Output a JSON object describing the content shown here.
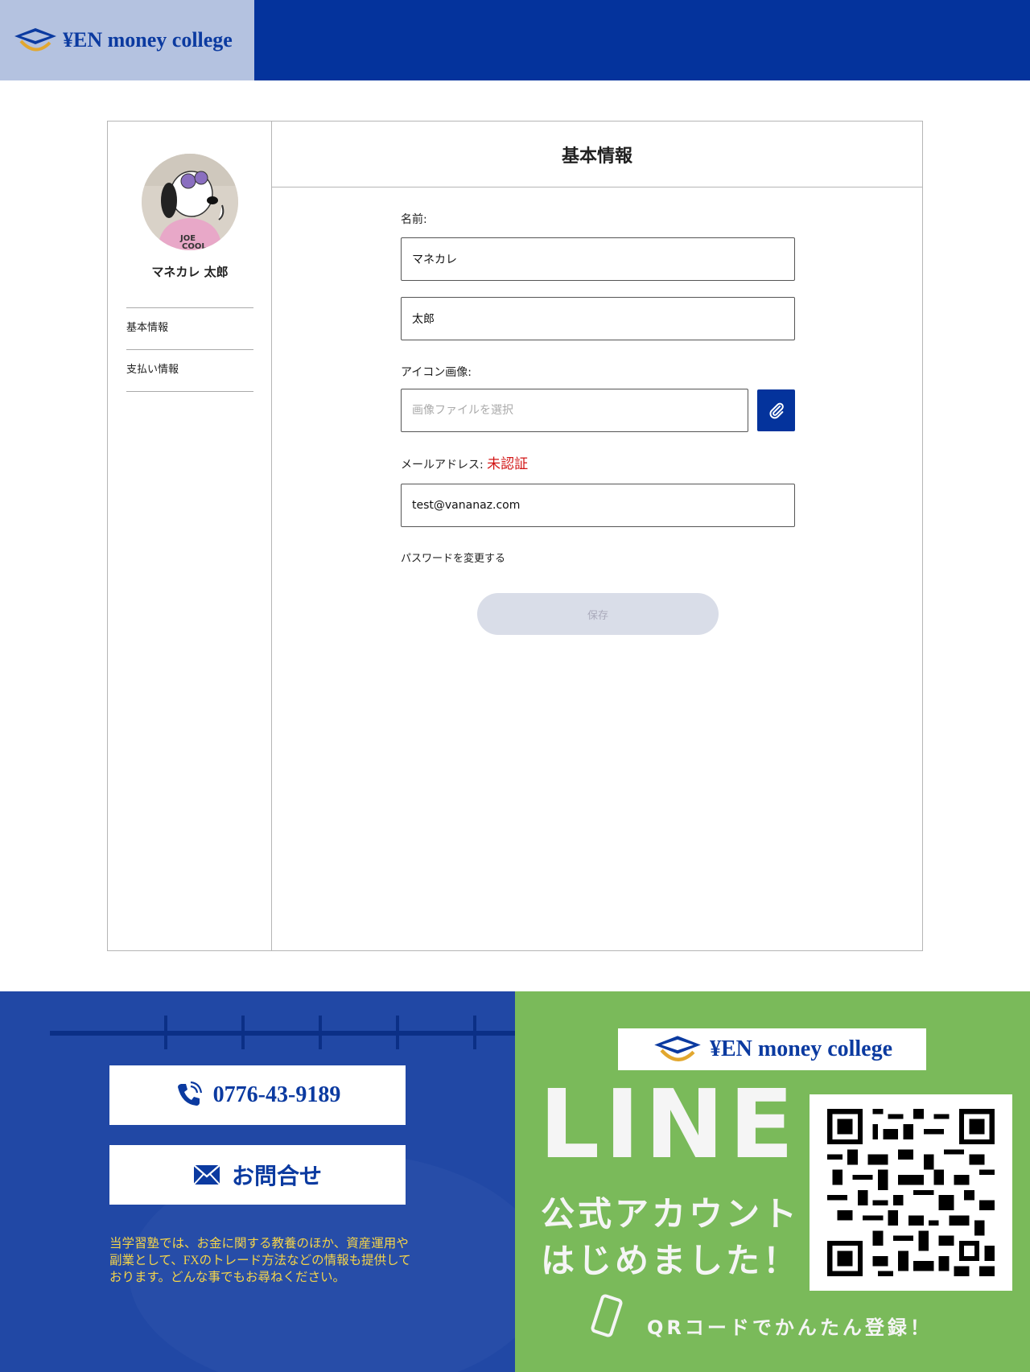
{
  "header": {
    "logo_text": "¥EN money college"
  },
  "profile": {
    "name": "マネカレ 太郎"
  },
  "sidebar": {
    "items": [
      {
        "label": "基本情報"
      },
      {
        "label": "支払い情報"
      }
    ]
  },
  "main": {
    "title": "基本情報",
    "name_label": "名前:",
    "last_name_value": "マネカレ",
    "first_name_value": "太郎",
    "icon_label": "アイコン画像:",
    "icon_placeholder": "画像ファイルを選択",
    "email_label": "メールアドレス:",
    "email_status": "未認証",
    "email_value": "test@vananaz.com",
    "change_password": "パスワードを変更する",
    "save_label": "保存"
  },
  "footer": {
    "phone": "0776-43-9189",
    "contact": "お問合せ",
    "description": "当学習塾では、お金に関する教養のほか、資産運用や副業として、FXのトレード方法などの情報も提供しております。どんな事でもお尋ねください。",
    "line_logo_text": "¥EN money college",
    "line_title": "LINE",
    "line_sub_1": "公式アカウント",
    "line_sub_2": "はじめました！",
    "qr_caption": "QRコードでかんたん登録！"
  },
  "colors": {
    "brand": "#04339c",
    "line_green": "#7aba5a",
    "alert": "#d21414",
    "gold": "#f4d44a"
  }
}
